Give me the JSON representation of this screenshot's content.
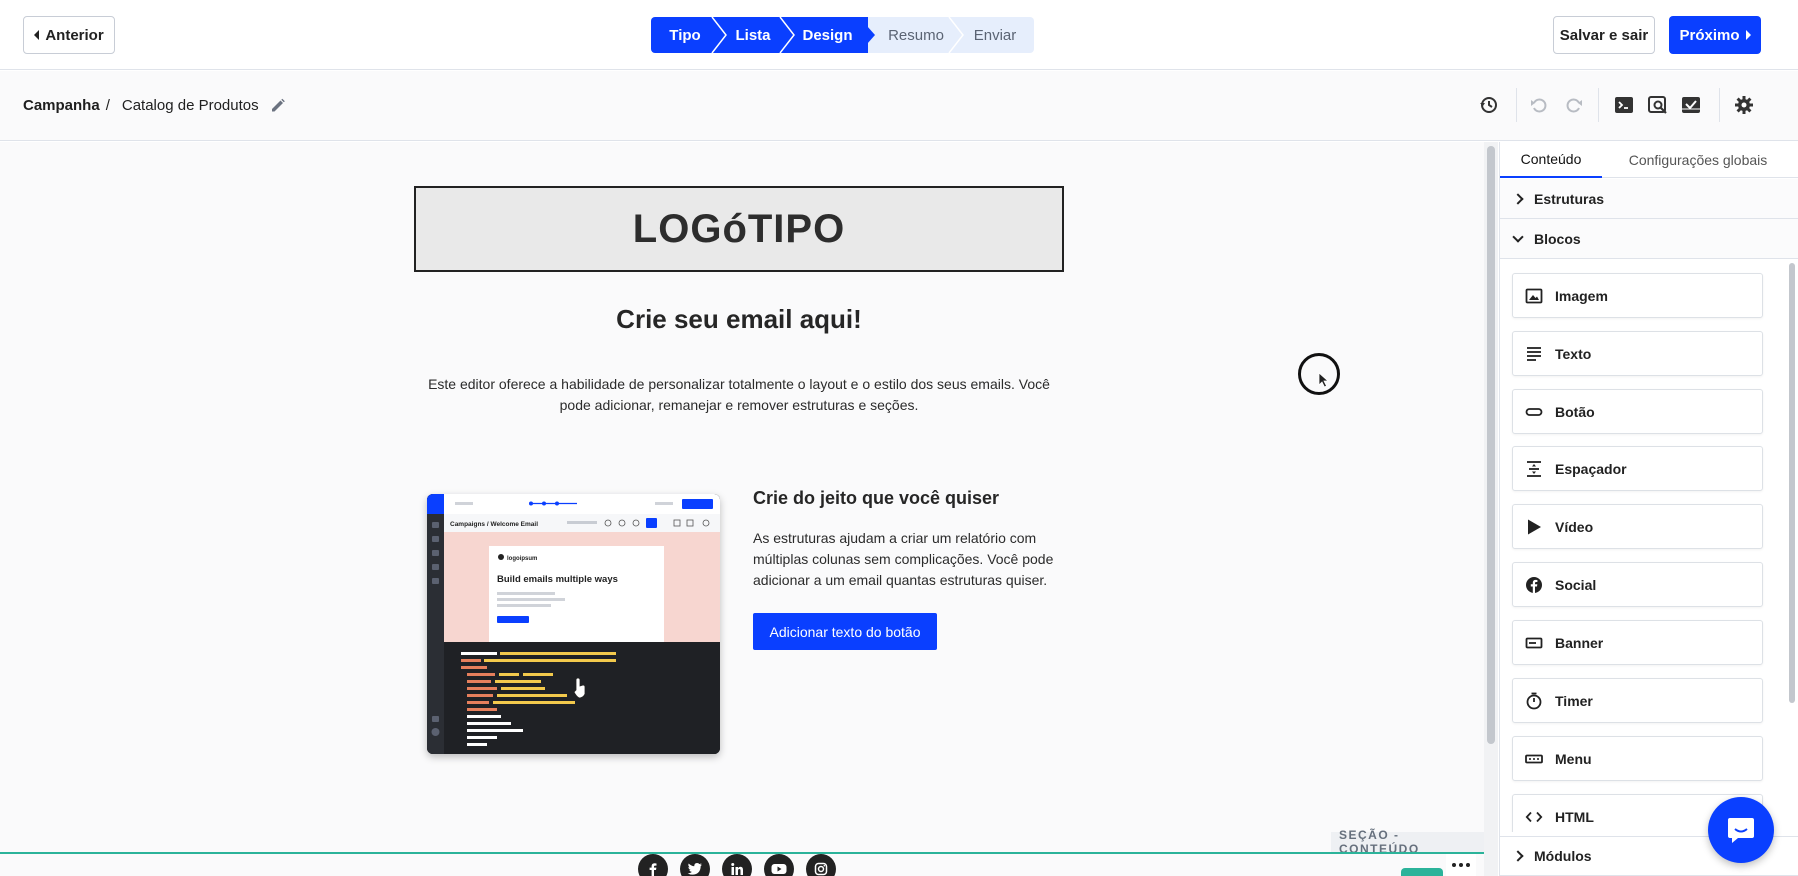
{
  "topbar": {
    "back_label": "Anterior",
    "steps": [
      {
        "label": "Tipo",
        "state": "done"
      },
      {
        "label": "Lista",
        "state": "done"
      },
      {
        "label": "Design",
        "state": "current"
      },
      {
        "label": "Resumo",
        "state": "pending"
      },
      {
        "label": "Enviar",
        "state": "pending"
      }
    ],
    "save_exit_label": "Salvar e sair",
    "next_label": "Próximo"
  },
  "breadcrumb": {
    "root": "Campanha",
    "separator": "/",
    "current": "Catalog de Produtos"
  },
  "toolbar": {
    "icons": [
      "history-icon",
      "undo-icon",
      "redo-icon",
      "code-icon",
      "preview-icon",
      "test-email-icon",
      "settings-icon"
    ]
  },
  "canvas": {
    "logo_text": "LOGóTIPO",
    "headline": "Crie seu email aqui!",
    "lead": "Este editor oferece a habilidade de personalizar totalmente o layout e o estilo dos seus emails. Você pode adicionar, remanejar e remover estruturas e seções.",
    "thumbnail": {
      "breadcrumb": "Campaigns / Welcome Email",
      "logo": "logoipsum",
      "heading": "Build emails multiple ways"
    },
    "column_title": "Crie do jeito que você quiser",
    "column_text": "As estruturas ajudam a criar um relatório com múltiplas colunas sem complicações. Você pode adicionar a um email quantas estruturas quiser.",
    "cta_label": "Adicionar texto do botão",
    "section_tag": "SEÇÃO - CONTEÚDO",
    "social_icons": [
      "facebook-icon",
      "twitter-icon",
      "linkedin-icon",
      "youtube-icon",
      "instagram-icon"
    ]
  },
  "panel": {
    "tabs": [
      "Conteúdo",
      "Configurações globais"
    ],
    "structures_label": "Estruturas",
    "blocks_label": "Blocos",
    "modules_label": "Módulos",
    "blocks": [
      {
        "label": "Imagem",
        "icon": "image-icon"
      },
      {
        "label": "Texto",
        "icon": "text-icon"
      },
      {
        "label": "Botão",
        "icon": "button-icon"
      },
      {
        "label": "Espaçador",
        "icon": "spacer-icon"
      },
      {
        "label": "Vídeo",
        "icon": "video-icon"
      },
      {
        "label": "Social",
        "icon": "facebook-icon"
      },
      {
        "label": "Banner",
        "icon": "banner-icon"
      },
      {
        "label": "Timer",
        "icon": "timer-icon"
      },
      {
        "label": "Menu",
        "icon": "menu-icon"
      },
      {
        "label": "HTML",
        "icon": "html-icon"
      }
    ]
  },
  "colors": {
    "accent": "#0a3fff",
    "step_pending_bg": "#e6eefc",
    "section_line": "#2bb39a"
  }
}
